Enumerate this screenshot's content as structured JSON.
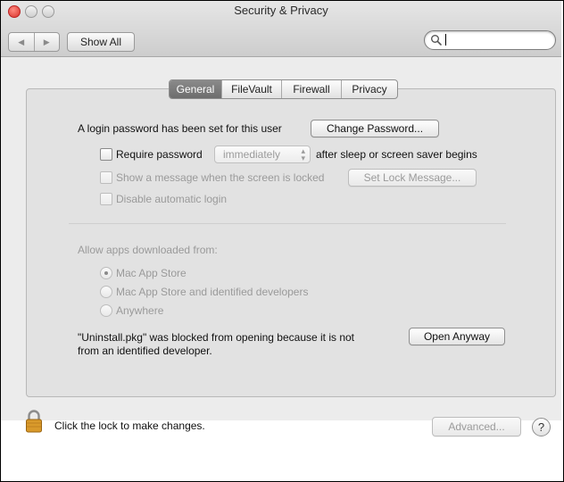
{
  "window": {
    "title": "Security & Privacy"
  },
  "toolbar": {
    "back_glyph": "◀",
    "forward_glyph": "▶",
    "show_all_label": "Show All",
    "search_value": "",
    "search_placeholder": ""
  },
  "tabs": [
    {
      "label": "General",
      "active": true
    },
    {
      "label": "FileVault",
      "active": false
    },
    {
      "label": "Firewall",
      "active": false
    },
    {
      "label": "Privacy",
      "active": false
    }
  ],
  "general": {
    "login_password_text": "A login password has been set for this user",
    "change_password_label": "Change Password...",
    "require_password_label": "Require password",
    "require_password_select_value": "immediately",
    "after_sleep_text": "after sleep or screen saver begins",
    "show_message_label": "Show a message when the screen is locked",
    "set_lock_message_label": "Set Lock Message...",
    "disable_auto_login_label": "Disable automatic login",
    "allow_apps_heading": "Allow apps downloaded from:",
    "radio_options": [
      {
        "label": "Mac App Store",
        "selected": true
      },
      {
        "label": "Mac App Store and identified developers",
        "selected": false
      },
      {
        "label": "Anywhere",
        "selected": false
      }
    ],
    "blocked_line1": "\"Uninstall.pkg\" was blocked from opening because it is not",
    "blocked_line2": "from an identified developer.",
    "open_anyway_label": "Open Anyway"
  },
  "footer": {
    "lock_text": "Click the lock to make changes.",
    "advanced_label": "Advanced...",
    "help_glyph": "?"
  },
  "colors": {
    "window_bg": "#ececec",
    "panel_bg": "#e2e2e2",
    "active_tab": "#7a7a7a",
    "disabled_text": "#9a9a9a",
    "close_button": "#d8312a",
    "lock_body": "#d99a2b"
  }
}
